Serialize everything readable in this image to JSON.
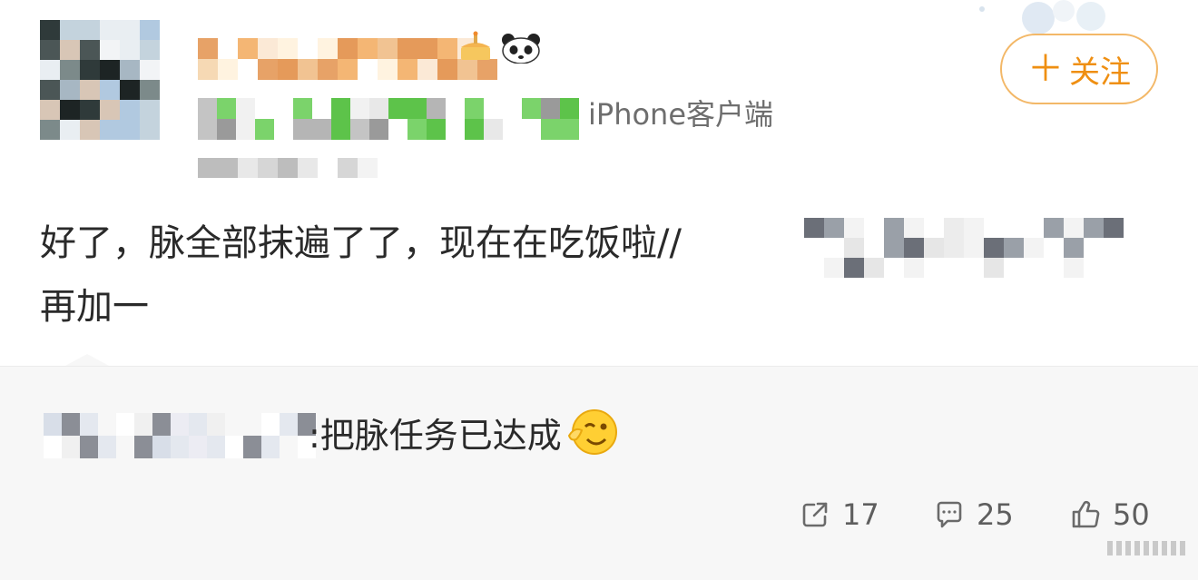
{
  "post": {
    "client": "iPhone客户端",
    "text_line1": "好了，脉全部抹遍了了，现在在吃饭啦//",
    "text_line2": "再加一"
  },
  "follow_button": {
    "plus": "＋",
    "label": "关注"
  },
  "quoted_reply": {
    "text": ":把脉任务已达成"
  },
  "actions": {
    "repost_count": "17",
    "comment_count": "25",
    "like_count": "50"
  },
  "colors": {
    "accent_orange": "#ef8f12",
    "follow_border": "#f3b868",
    "panel_bg": "#f7f7f7",
    "muted_text": "#5e5e5e"
  }
}
